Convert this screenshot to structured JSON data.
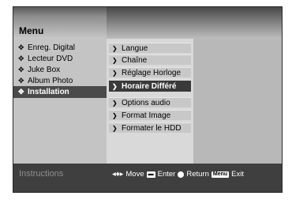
{
  "header": {
    "title": "Menu"
  },
  "menu": {
    "items": [
      {
        "label": "Enreg. Digital",
        "icon": "plus-icon",
        "selected": false
      },
      {
        "label": "Lecteur DVD",
        "icon": "plus-icon",
        "selected": false
      },
      {
        "label": "Juke Box",
        "icon": "plus-icon",
        "selected": false
      },
      {
        "label": "Album Photo",
        "icon": "plus-icon",
        "selected": false
      },
      {
        "label": "Installation",
        "icon": "plus-icon",
        "selected": true
      }
    ]
  },
  "submenu": {
    "items": [
      {
        "label": "Langue",
        "selected": false
      },
      {
        "label": "Chaîne",
        "selected": false
      },
      {
        "label": "Réglage Horloge",
        "selected": false
      },
      {
        "label": "Horaire Différé",
        "selected": true
      },
      {
        "label": "Options audio",
        "selected": false
      },
      {
        "label": "Format Image",
        "selected": false
      },
      {
        "label": "Formater le HDD",
        "selected": false
      }
    ]
  },
  "footer": {
    "instructions_label": "Instructions",
    "move_label": "Move",
    "enter_label": "Enter",
    "return_label": "Return",
    "menu_key_label": "Menu",
    "exit_label": "Exit"
  }
}
